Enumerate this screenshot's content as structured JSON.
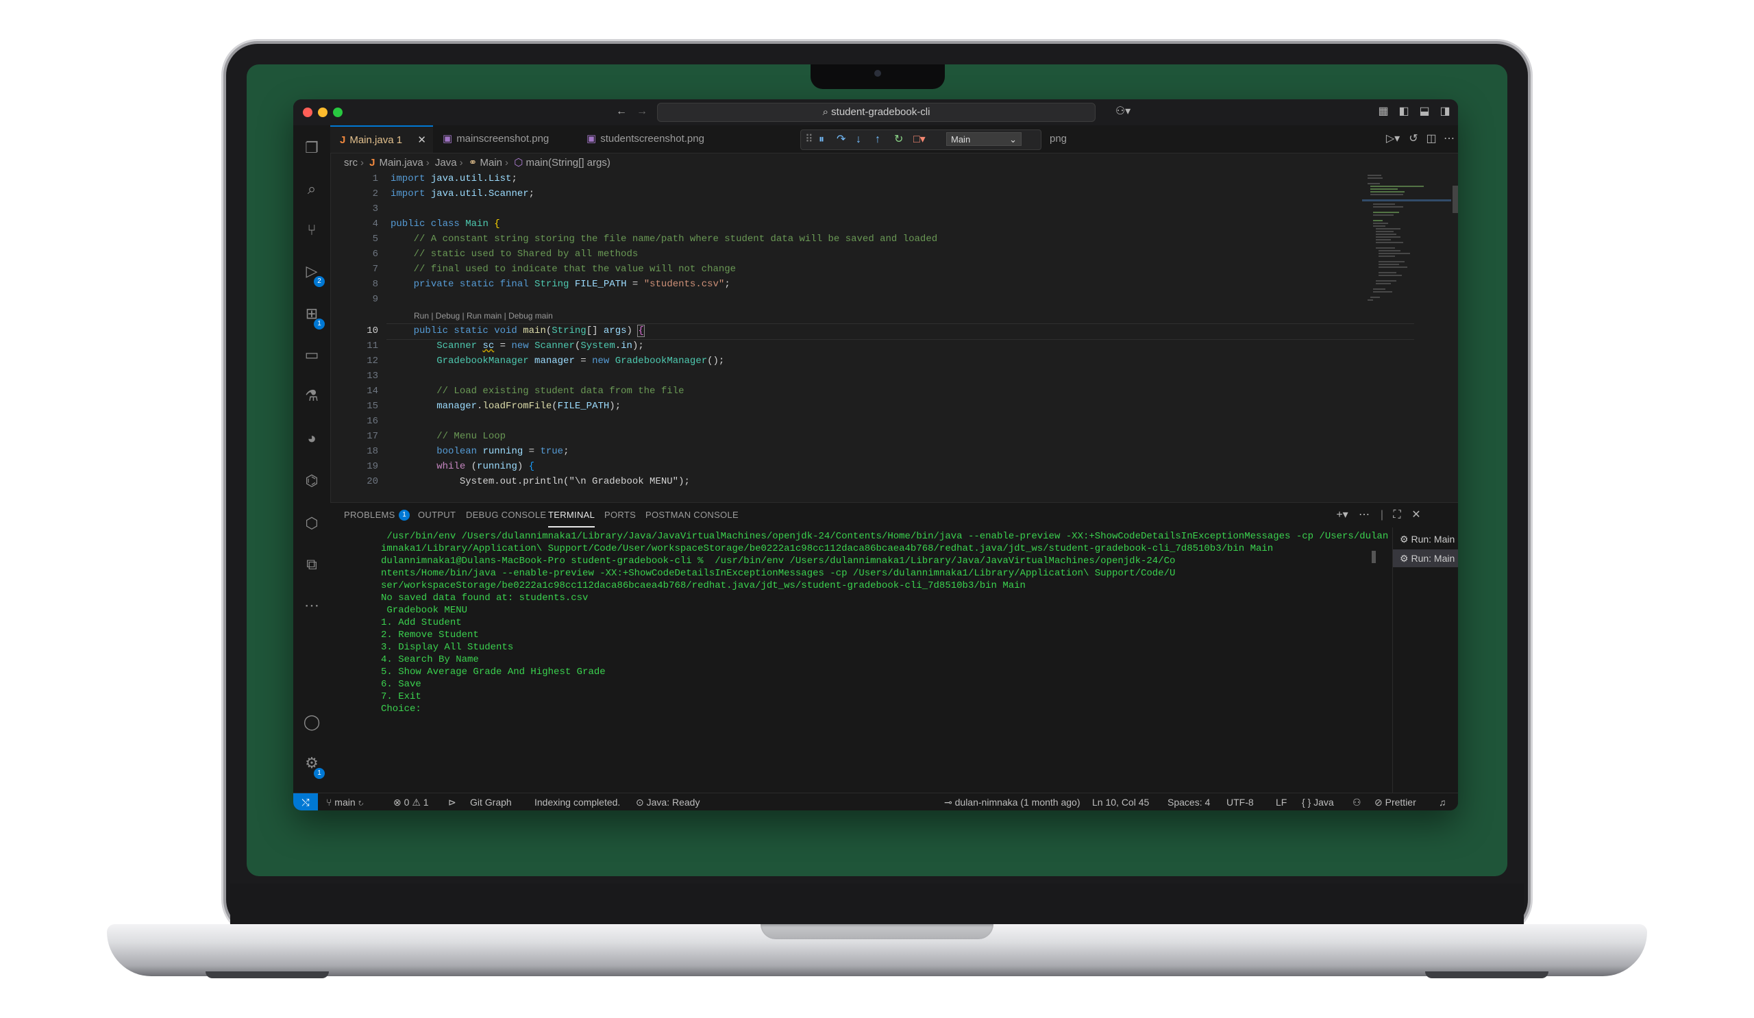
{
  "window": {
    "search_text": "student-gradebook-cli",
    "tabs": [
      {
        "label": "Main.java 1",
        "icon": "java-file-icon",
        "active": true
      },
      {
        "label": "mainscreenshot.png",
        "icon": "image-file-icon",
        "active": false
      },
      {
        "label": "studentscreenshot.png",
        "icon": "image-file-icon",
        "active": false
      },
      {
        "label": "png",
        "icon": "",
        "active": false
      }
    ],
    "debug_config": "Main"
  },
  "breadcrumbs": [
    "src",
    "Main.java",
    "Java",
    "Main",
    "main(String[] args)"
  ],
  "editor": {
    "current_line": 10,
    "codelens": "Run | Debug | Run main | Debug main",
    "lines": [
      {
        "n": "1",
        "text": "import java.util.List;"
      },
      {
        "n": "2",
        "text": "import java.util.Scanner;"
      },
      {
        "n": "3",
        "text": ""
      },
      {
        "n": "4",
        "text": "public class Main {"
      },
      {
        "n": "5",
        "text": "    // A constant string storing the file name/path where student data will be saved and loaded"
      },
      {
        "n": "6",
        "text": "    // static used to Shared by all methods"
      },
      {
        "n": "7",
        "text": "    // final used to indicate that the value will not change"
      },
      {
        "n": "8",
        "text": "    private static final String FILE_PATH = \"students.csv\";"
      },
      {
        "n": "9",
        "text": ""
      },
      {
        "n": "10",
        "text": "    public static void main(String[] args) {"
      },
      {
        "n": "11",
        "text": "        Scanner sc = new Scanner(System.in);"
      },
      {
        "n": "12",
        "text": "        GradebookManager manager = new GradebookManager();"
      },
      {
        "n": "13",
        "text": ""
      },
      {
        "n": "14",
        "text": "        // Load existing student data from the file"
      },
      {
        "n": "15",
        "text": "        manager.loadFromFile(FILE_PATH);"
      },
      {
        "n": "16",
        "text": ""
      },
      {
        "n": "17",
        "text": "        // Menu Loop"
      },
      {
        "n": "18",
        "text": "        boolean running = true;"
      },
      {
        "n": "19",
        "text": "        while (running) {"
      },
      {
        "n": "20",
        "text": "            System.out.println(\"\\n Gradebook MENU\");"
      }
    ]
  },
  "panel": {
    "tabs": [
      "PROBLEMS",
      "OUTPUT",
      "DEBUG CONSOLE",
      "TERMINAL",
      "PORTS",
      "POSTMAN CONSOLE"
    ],
    "problems_count": "1",
    "active_tab": "TERMINAL",
    "terminal_lines": [
      " /usr/bin/env /Users/dulannimnaka1/Library/Java/JavaVirtualMachines/openjdk-24/Contents/Home/bin/java --enable-preview -XX:+ShowCodeDetailsInExceptionMessages -cp /Users/dulann",
      "imnaka1/Library/Application\\ Support/Code/User/workspaceStorage/be0222a1c98cc112daca86bcaea4b768/redhat.java/jdt_ws/student-gradebook-cli_7d8510b3/bin Main",
      "dulannimnaka1@Dulans-MacBook-Pro student-gradebook-cli %  /usr/bin/env /Users/dulannimnaka1/Library/Java/JavaVirtualMachines/openjdk-24/Co",
      "ntents/Home/bin/java --enable-preview -XX:+ShowCodeDetailsInExceptionMessages -cp /Users/dulannimnaka1/Library/Application\\ Support/Code/U",
      "ser/workspaceStorage/be0222a1c98cc112daca86bcaea4b768/redhat.java/jdt_ws/student-gradebook-cli_7d8510b3/bin Main",
      "No saved data found at: students.csv",
      "",
      " Gradebook MENU",
      "1. Add Student",
      "2. Remove Student",
      "3. Display All Students",
      "4. Search By Name",
      "5. Show Average Grade And Highest Grade",
      "6. Save",
      "7. Exit",
      "Choice:"
    ],
    "terminal_instances": [
      "Run: Main",
      "Run: Main"
    ]
  },
  "status": {
    "branch": "main",
    "errors": "0",
    "warnings": "1",
    "git_graph": "Git Graph",
    "indexing": "Indexing completed.",
    "java_status": "Java: Ready",
    "blame": "dulan-nimnaka (1 month ago)",
    "position": "Ln 10, Col 45",
    "spaces": "Spaces: 4",
    "encoding": "UTF-8",
    "eol": "LF",
    "language": "Java",
    "formatter": "Prettier"
  },
  "badges": {
    "run_debug": "2",
    "extensions": "1",
    "settings": "1"
  },
  "colors": {
    "screen_green": "#1f5539",
    "accent": "#0078d4",
    "terminal_green": "#3bd24f"
  }
}
